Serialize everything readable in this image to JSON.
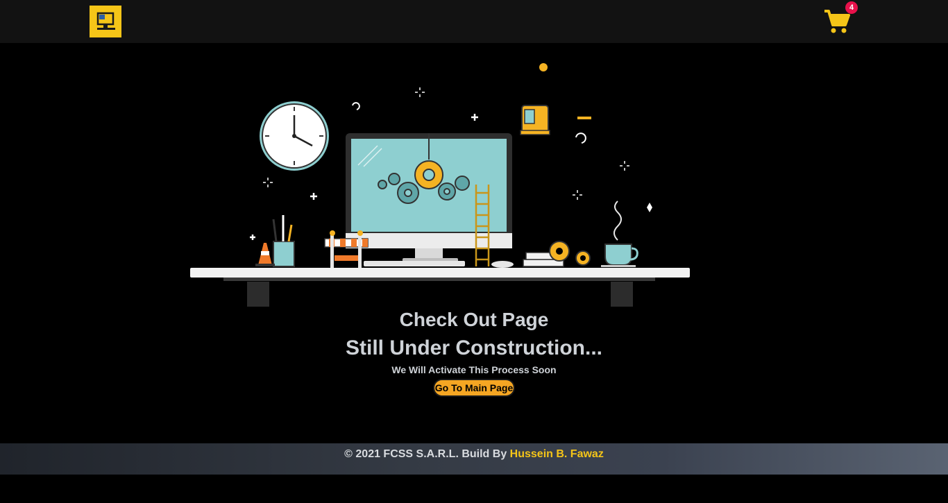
{
  "header": {
    "cart_count": "4"
  },
  "main": {
    "title_line1": "Check Out Page",
    "title_line2": "Still Under Construction...",
    "subtitle": "We Will Activate This Process Soon",
    "button_label": "Go To Main Page"
  },
  "footer": {
    "copyright": "© 2021 FCSS S.A.R.L. Build By ",
    "author": "Hussein B. Fawaz"
  },
  "colors": {
    "accent": "#f5c518",
    "button": "#f5a623",
    "badge": "#e8114b",
    "screen": "#8ecfd0"
  }
}
